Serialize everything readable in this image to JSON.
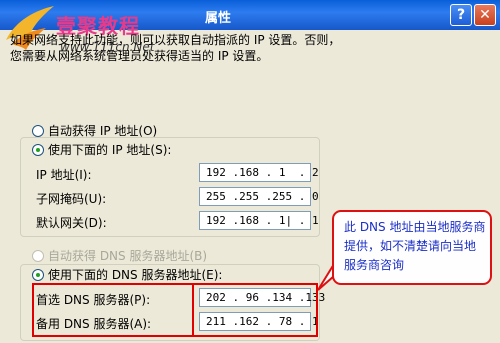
{
  "window": {
    "title": "属性",
    "help_glyph": "?",
    "close_glyph": "✕"
  },
  "watermark": {
    "brand": "壹聚教程",
    "url": "www.111cn.Net"
  },
  "info_text": {
    "line1": "如果网络支持此功能，则可以获取自动指派的 IP 设置。否则，",
    "line2": "您需要从网络系统管理员处获得适当的 IP 设置。"
  },
  "ip_section": {
    "auto_option": "自动获得 IP 地址(O)",
    "manual_option": "使用下面的 IP 地址(S):",
    "ip_label": "IP 地址(I):",
    "ip_value": "192 .168 . 1  . 2",
    "mask_label": "子网掩码(U):",
    "mask_value": "255 .255 .255 . 0",
    "gateway_label": "默认网关(D):",
    "gateway_value": "192 .168 . 1| . 1"
  },
  "dns_section": {
    "auto_option": "自动获得 DNS 服务器地址(B)",
    "manual_option": "使用下面的 DNS 服务器地址(E):",
    "preferred_label": "首选 DNS 服务器(P):",
    "preferred_value": "202 . 96 .134 .133",
    "alternate_label": "备用 DNS 服务器(A):",
    "alternate_value": "211 .162 . 78 . 1"
  },
  "callout": {
    "text": "此 DNS 地址由当地服务商提供，如不清楚请向当地服务商咨询"
  },
  "colors": {
    "titlebar": "#1758c9",
    "dialog_bg": "#ece9d8",
    "highlight_red": "#e00000",
    "callout_text": "#1a2fc8",
    "watermark_pink": "#e83a8a"
  }
}
